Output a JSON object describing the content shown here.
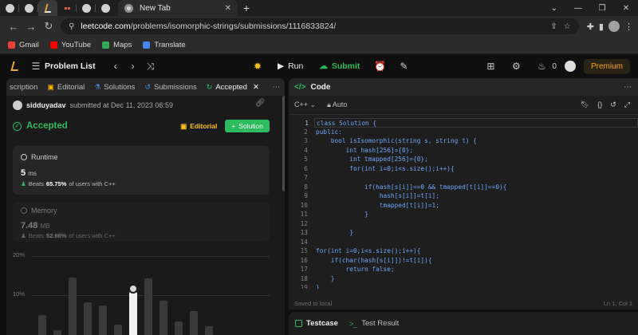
{
  "browser": {
    "new_tab_title": "New Tab",
    "url_domain": "leetcode.com",
    "url_path": "/problems/isomorphic-strings/submissions/1116833824/",
    "bookmarks": [
      {
        "label": "Gmail",
        "color": "#ea4335"
      },
      {
        "label": "YouTube",
        "color": "#ff0000"
      },
      {
        "label": "Maps",
        "color": "#34a853"
      },
      {
        "label": "Translate",
        "color": "#4285f4"
      }
    ]
  },
  "header": {
    "problem_list": "Problem List",
    "run": "Run",
    "submit": "Submit",
    "streak": "0",
    "premium": "Premium"
  },
  "left": {
    "tabs": [
      {
        "label": "scription",
        "icon": "description-icon"
      },
      {
        "label": "Editorial",
        "icon": "book-icon"
      },
      {
        "label": "Solutions",
        "icon": "flask-icon"
      },
      {
        "label": "Submissions",
        "icon": "history-icon"
      },
      {
        "label": "Accepted",
        "icon": "check-icon"
      }
    ],
    "user": "sidduyadav",
    "submitted_text": "submitted at Dec 11, 2023 06:59",
    "status": "Accepted",
    "editorial_btn": "Editorial",
    "solution_btn": "Solution",
    "runtime": {
      "label": "Runtime",
      "value": "5",
      "unit": "ms",
      "beats_prefix": "Beats",
      "beats_pct": "65.75%",
      "beats_suffix": "of users with C++"
    },
    "memory": {
      "label": "Memory",
      "value": "7.48",
      "unit": "MB",
      "beats_prefix": "Beats",
      "beats_pct": "52.66%",
      "beats_suffix": "of users with C++"
    },
    "hist_axis": [
      "20%",
      "10%"
    ],
    "hist_bars": [
      5,
      1.2,
      14.5,
      8.2,
      7.4,
      2.6,
      11,
      14.4,
      8.6,
      3.4,
      6,
      2.3
    ],
    "my_bar_index": 6
  },
  "right": {
    "title": "Code",
    "language": "C++",
    "mode": "Auto",
    "status_saved": "Saved to local",
    "cursor_pos": "Ln 1, Col 1",
    "code_lines": [
      "class Solution {",
      "public:",
      "    bool isIsomorphic(string s, string t) {",
      "        int hash[256]={0};",
      "         int tmapped[256]={0};",
      "         for(int i=0;i<s.size();i++){",
      "",
      "             if(hash[s[i]]==0 && tmapped[t[i]]==0){",
      "                 hash[s[i]]=t[i];",
      "                 tmapped[t[i]]=1;",
      "             }",
      "",
      "         }",
      "",
      "for(int i=0;i<s.size();i++){",
      "    if(char(hash[s[i]])!=t[i]){",
      "        return false;",
      "    }",
      "}"
    ]
  },
  "bottom": {
    "testcase": "Testcase",
    "test_result": "Test Result"
  }
}
